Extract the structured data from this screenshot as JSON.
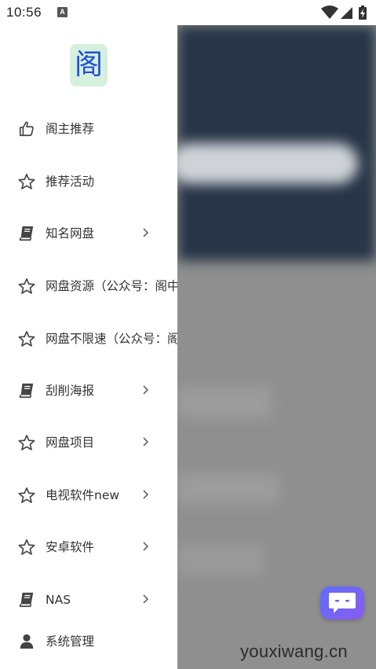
{
  "status_bar": {
    "time": "10:56",
    "notification_badge": "A",
    "icons": [
      "wifi-icon",
      "signal-icon",
      "battery-charging-icon"
    ]
  },
  "drawer": {
    "logo_char": "阁",
    "items": [
      {
        "label": "阁主推荐",
        "icon": "thumbs-up-icon",
        "has_chevron": false
      },
      {
        "label": "推荐活动",
        "icon": "star-icon",
        "has_chevron": false
      },
      {
        "label": "知名网盘",
        "icon": "book-icon",
        "has_chevron": true
      },
      {
        "label": "网盘资源（公众号：阁中",
        "icon": "star-icon",
        "has_chevron": false
      },
      {
        "label": "网盘不限速（公众号：阁",
        "icon": "star-icon",
        "has_chevron": false
      },
      {
        "label": "刮削海报",
        "icon": "book-icon",
        "has_chevron": true
      },
      {
        "label": "网盘项目",
        "icon": "star-icon",
        "has_chevron": true
      },
      {
        "label": "电视软件new",
        "icon": "star-icon",
        "has_chevron": true
      },
      {
        "label": "安卓软件",
        "icon": "star-icon",
        "has_chevron": true
      },
      {
        "label": "NAS",
        "icon": "book-icon",
        "has_chevron": true
      },
      {
        "label": "系统管理",
        "icon": "user-icon",
        "has_chevron": false
      }
    ]
  },
  "chat_fab": {
    "icon": "chat-icon"
  },
  "watermark": "youxiwang.cn",
  "colors": {
    "logo_bg": "#d6f0de",
    "logo_char": "#1f4fd6",
    "fab_start": "#5f6df7",
    "fab_end": "#8a5cf0",
    "scrim": "#8f8f8f"
  }
}
